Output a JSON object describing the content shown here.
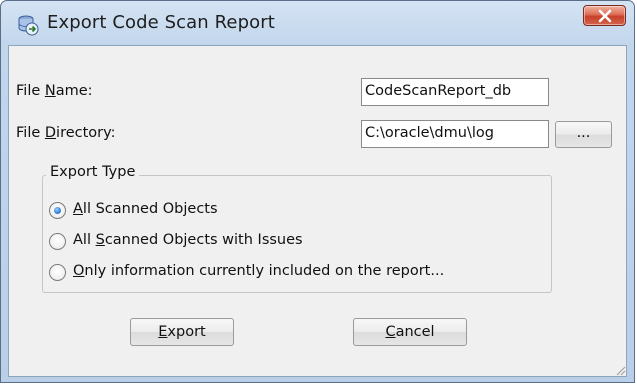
{
  "window": {
    "title": "Export Code Scan Report",
    "close_label": "x"
  },
  "form": {
    "file_name_label_mnemonic_prefix": "File ",
    "file_name_label_mnemonic": "N",
    "file_name_label_rest": "ame:",
    "file_name_value": "CodeScanReport_db",
    "file_directory_label_prefix": "File ",
    "file_directory_label_mnemonic": "D",
    "file_directory_label_rest": "irectory:",
    "file_directory_value": "C:\\oracle\\dmu\\log",
    "browse_label": "..."
  },
  "export_type": {
    "title": "Export Type",
    "options": [
      {
        "mnemonic": "A",
        "rest": "ll Scanned Objects",
        "prefix": "",
        "checked": true
      },
      {
        "prefix": "All ",
        "mnemonic": "S",
        "rest": "canned Objects with Issues",
        "checked": false
      },
      {
        "prefix": "",
        "mnemonic": "O",
        "rest": "nly information currently included on the report...",
        "checked": false
      }
    ]
  },
  "buttons": {
    "export_mnemonic": "E",
    "export_rest": "xport",
    "cancel_mnemonic": "C",
    "cancel_rest": "ancel"
  },
  "colors": {
    "title_bar": "#c2d6ec",
    "close_button": "#c7402a",
    "dialog_background": "#f0f0f0",
    "radio_selected": "#2f7fd8"
  },
  "icons": {
    "app": "database-export-icon",
    "close": "close-icon",
    "grip": "resize-grip-icon"
  }
}
